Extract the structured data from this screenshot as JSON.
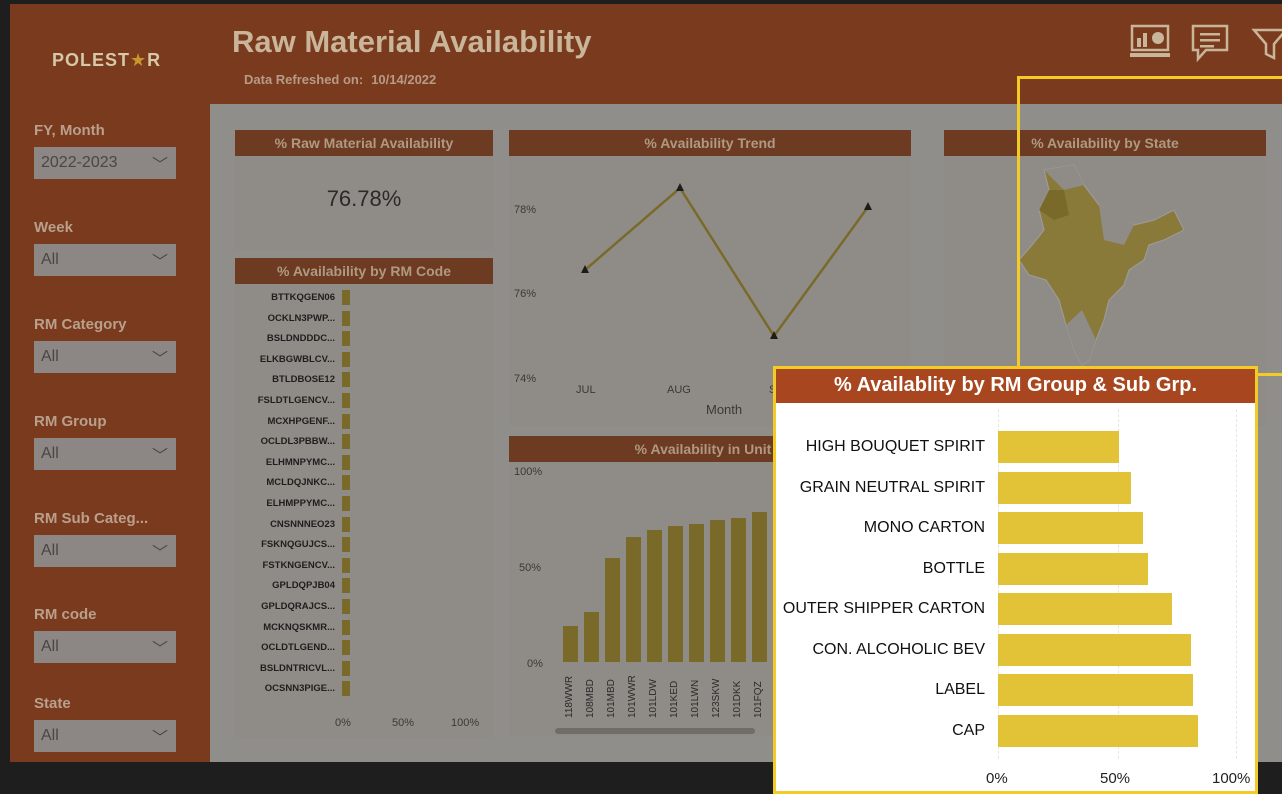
{
  "app": {
    "logo_text_a": "POLEST",
    "logo_star": "★",
    "logo_text_b": "R",
    "title": "Raw Material Availability",
    "refresh_label": "Data Refreshed on:",
    "refresh_date": "10/14/2022"
  },
  "header_icons": [
    "dashboard-icon",
    "chat-icon",
    "filter-icon"
  ],
  "slicers": [
    {
      "label": "FY, Month",
      "value": "2022-2023"
    },
    {
      "label": "Week",
      "value": "All"
    },
    {
      "label": "RM Category",
      "value": "All"
    },
    {
      "label": "RM Group",
      "value": "All"
    },
    {
      "label": "RM Sub Categ...",
      "value": "All"
    },
    {
      "label": "RM code",
      "value": "All"
    },
    {
      "label": "State",
      "value": "All"
    }
  ],
  "cards": {
    "kpi_title": "% Raw Material Availability",
    "kpi_value": "76.78%",
    "trend_title": "% Availability Trend",
    "state_title": "% Availability by State",
    "rmcode_title": "% Availability by RM Code",
    "unit_title": "% Availability in Unit C"
  },
  "rm_codes": [
    "BTTKQGEN06",
    "OCKLN3PWP...",
    "BSLDNDDDC...",
    "ELKBGWBLCV...",
    "BTLDBOSE12",
    "FSLDTLGENCV...",
    "MCXHPGENF...",
    "OCLDL3PBBW...",
    "ELHMNPYMC...",
    "MCLDQJNKC...",
    "ELHMPPYMC...",
    "CNSNNNEO23",
    "FSKNQGUJCS...",
    "FSTKNGENCV...",
    "GPLDQPJB04",
    "GPLDQRAJCS...",
    "MCKNQSKMR...",
    "OCLDTLGEND...",
    "BSLDNTRICVL...",
    "OCSNN3PIGE..."
  ],
  "rm_axis": [
    "0%",
    "50%",
    "100%"
  ],
  "trend": {
    "months": [
      "JUL",
      "AUG",
      "S"
    ],
    "xlabel": "Month",
    "yticks": [
      "78%",
      "76%",
      "74%"
    ]
  },
  "unit": {
    "yticks": [
      "100%",
      "50%",
      "0%"
    ],
    "units": [
      "118WWR",
      "108MBD",
      "101MBD",
      "101WWR",
      "101LDW",
      "101KED",
      "101LWN",
      "123SKW",
      "101DKK",
      "101FQZ"
    ],
    "values": [
      19,
      26,
      54,
      65,
      69,
      71,
      72,
      74,
      75,
      78
    ]
  },
  "zoom": {
    "title": "% Availablity by RM Group & Sub Grp.",
    "ticks": [
      "0%",
      "50%",
      "100%"
    ]
  },
  "chart_data": {
    "type": "bar",
    "title": "% Availablity by RM Group & Sub Grp.",
    "orientation": "horizontal",
    "categories": [
      "HIGH BOUQUET SPIRIT",
      "GRAIN NEUTRAL SPIRIT",
      "MONO CARTON",
      "BOTTLE",
      "OUTER SHIPPER CARTON",
      "CON. ALCOHOLIC BEV",
      "LABEL",
      "CAP"
    ],
    "values": [
      51,
      56,
      61,
      63,
      73,
      81,
      82,
      84
    ],
    "xlim": [
      0,
      100
    ],
    "xlabel": "",
    "ylabel": ""
  }
}
